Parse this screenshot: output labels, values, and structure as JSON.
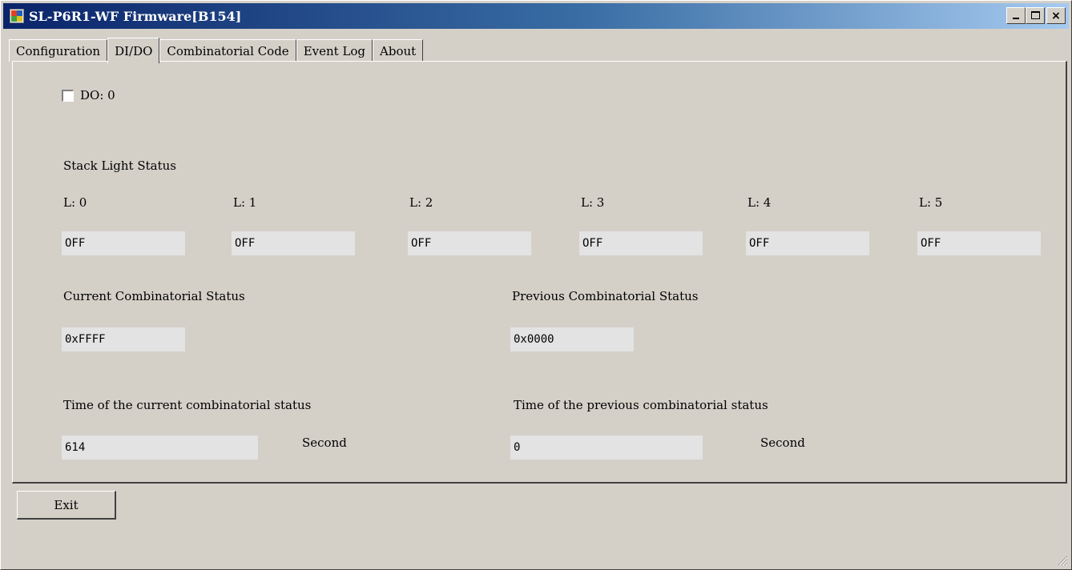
{
  "window": {
    "title": "SL-P6R1-WF Firmware[B154]",
    "controls": {
      "minimize_icon": "minimize-icon",
      "maximize_icon": "maximize-icon",
      "close_glyph": "×"
    }
  },
  "tabs": [
    {
      "label": "Configuration",
      "active": false
    },
    {
      "label": "DI/DO",
      "active": true
    },
    {
      "label": "Combinatorial Code",
      "active": false
    },
    {
      "label": "Event Log",
      "active": false
    },
    {
      "label": "About",
      "active": false
    }
  ],
  "dido": {
    "do_checkbox": {
      "label": "DO: 0",
      "checked": false
    },
    "stack_light_title": "Stack Light Status",
    "lights": [
      {
        "label": "L: 0",
        "value": "OFF"
      },
      {
        "label": "L: 1",
        "value": "OFF"
      },
      {
        "label": "L: 2",
        "value": "OFF"
      },
      {
        "label": "L: 3",
        "value": "OFF"
      },
      {
        "label": "L: 4",
        "value": "OFF"
      },
      {
        "label": "L: 5",
        "value": "OFF"
      }
    ],
    "current_status": {
      "label": "Current Combinatorial Status",
      "value": "0xFFFF"
    },
    "previous_status": {
      "label": "Previous Combinatorial Status",
      "value": "0x0000"
    },
    "current_time": {
      "label": "Time of the current combinatorial status",
      "value": "614",
      "unit": "Second"
    },
    "previous_time": {
      "label": "Time of the previous combinatorial status",
      "value": "0",
      "unit": "Second"
    }
  },
  "footer": {
    "exit_label": "Exit"
  },
  "colors": {
    "titlebar_start": "#0a246a",
    "titlebar_end": "#a6caf0",
    "face": "#d4d0c8",
    "field_bg": "#e3e3e3"
  }
}
